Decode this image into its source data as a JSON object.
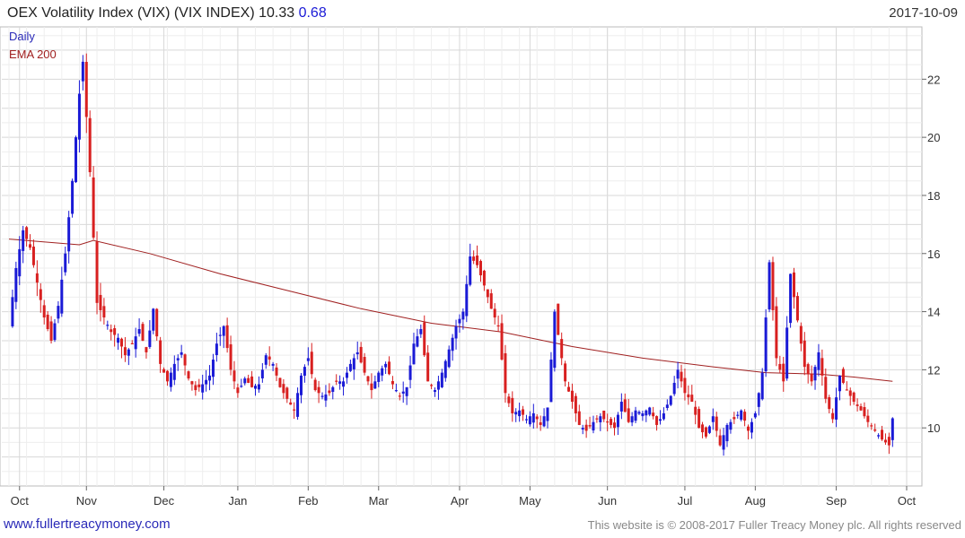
{
  "header": {
    "title": "OEX Volatility Index (VIX) (VIX INDEX) 10.33",
    "change": "0.68",
    "date": "2017-10-09"
  },
  "legend": {
    "daily": "Daily",
    "ema": "EMA 200"
  },
  "footer": {
    "site": "www.fullertreacymoney.com",
    "copyright": "This website is © 2008-2017 Fuller Treacy Money plc. All rights reserved"
  },
  "colors": {
    "up": "#1a1ad6",
    "down": "#d82020",
    "ema": "#a02020",
    "grid": "#e4e4e4"
  },
  "chart_data": {
    "type": "candlestick",
    "ylim": [
      8,
      23.8
    ],
    "yticks": [
      10,
      12,
      14,
      16,
      18,
      20,
      22
    ],
    "xlim": [
      0,
      250
    ],
    "months": [
      {
        "label": "Oct",
        "x": 3
      },
      {
        "label": "Nov",
        "x": 22
      },
      {
        "label": "Dec",
        "x": 44
      },
      {
        "label": "Jan",
        "x": 65
      },
      {
        "label": "Feb",
        "x": 85
      },
      {
        "label": "Mar",
        "x": 105
      },
      {
        "label": "Apr",
        "x": 128
      },
      {
        "label": "May",
        "x": 148
      },
      {
        "label": "Jun",
        "x": 170
      },
      {
        "label": "Jul",
        "x": 192
      },
      {
        "label": "Aug",
        "x": 212
      },
      {
        "label": "Sep",
        "x": 235
      },
      {
        "label": "Oct",
        "x": 255
      }
    ],
    "close_anchors": [
      [
        0,
        13.5
      ],
      [
        2,
        15.5
      ],
      [
        4,
        16.8
      ],
      [
        6,
        16.2
      ],
      [
        8,
        15.0
      ],
      [
        10,
        13.8
      ],
      [
        12,
        13.0
      ],
      [
        14,
        14.2
      ],
      [
        16,
        16.0
      ],
      [
        18,
        18.5
      ],
      [
        20,
        21.5
      ],
      [
        21,
        22.6
      ],
      [
        23,
        18.8
      ],
      [
        25,
        14.3
      ],
      [
        27,
        13.8
      ],
      [
        29,
        13.3
      ],
      [
        31,
        13.1
      ],
      [
        33,
        12.5
      ],
      [
        35,
        12.9
      ],
      [
        37,
        13.4
      ],
      [
        39,
        12.6
      ],
      [
        41,
        14.1
      ],
      [
        43,
        12.2
      ],
      [
        45,
        11.6
      ],
      [
        47,
        12.2
      ],
      [
        49,
        12.6
      ],
      [
        51,
        11.7
      ],
      [
        53,
        11.3
      ],
      [
        55,
        11.5
      ],
      [
        57,
        11.8
      ],
      [
        59,
        12.9
      ],
      [
        61,
        13.5
      ],
      [
        63,
        12.0
      ],
      [
        65,
        11.2
      ],
      [
        67,
        11.7
      ],
      [
        69,
        11.4
      ],
      [
        71,
        11.5
      ],
      [
        73,
        12.5
      ],
      [
        75,
        12.2
      ],
      [
        77,
        11.4
      ],
      [
        79,
        11.0
      ],
      [
        81,
        10.6
      ],
      [
        83,
        11.8
      ],
      [
        85,
        12.4
      ],
      [
        87,
        11.3
      ],
      [
        89,
        11.1
      ],
      [
        91,
        11.2
      ],
      [
        93,
        11.6
      ],
      [
        95,
        11.6
      ],
      [
        97,
        12.2
      ],
      [
        99,
        12.6
      ],
      [
        101,
        11.9
      ],
      [
        103,
        11.3
      ],
      [
        105,
        11.9
      ],
      [
        107,
        12.2
      ],
      [
        109,
        11.5
      ],
      [
        111,
        11.1
      ],
      [
        113,
        11.4
      ],
      [
        115,
        12.9
      ],
      [
        117,
        13.4
      ],
      [
        119,
        11.6
      ],
      [
        121,
        11.3
      ],
      [
        123,
        11.9
      ],
      [
        125,
        12.7
      ],
      [
        127,
        13.5
      ],
      [
        129,
        14.0
      ],
      [
        131,
        15.9
      ],
      [
        133,
        15.6
      ],
      [
        135,
        14.9
      ],
      [
        137,
        14.1
      ],
      [
        139,
        13.5
      ],
      [
        141,
        11.2
      ],
      [
        143,
        10.5
      ],
      [
        145,
        10.6
      ],
      [
        147,
        10.3
      ],
      [
        149,
        10.5
      ],
      [
        151,
        10.1
      ],
      [
        153,
        10.7
      ],
      [
        155,
        14.0
      ],
      [
        156,
        13.2
      ],
      [
        158,
        11.6
      ],
      [
        160,
        10.9
      ],
      [
        162,
        10.1
      ],
      [
        164,
        9.9
      ],
      [
        166,
        10.2
      ],
      [
        168,
        10.4
      ],
      [
        170,
        10.2
      ],
      [
        172,
        10.0
      ],
      [
        174,
        10.9
      ],
      [
        176,
        10.2
      ],
      [
        178,
        10.6
      ],
      [
        180,
        10.5
      ],
      [
        182,
        10.7
      ],
      [
        184,
        10.1
      ],
      [
        186,
        10.5
      ],
      [
        188,
        11.1
      ],
      [
        190,
        12.0
      ],
      [
        192,
        11.2
      ],
      [
        194,
        10.9
      ],
      [
        196,
        10.0
      ],
      [
        198,
        9.7
      ],
      [
        200,
        10.4
      ],
      [
        202,
        9.4
      ],
      [
        204,
        10.1
      ],
      [
        206,
        10.3
      ],
      [
        208,
        10.6
      ],
      [
        210,
        9.9
      ],
      [
        212,
        10.5
      ],
      [
        214,
        11.9
      ],
      [
        216,
        15.7
      ],
      [
        218,
        12.4
      ],
      [
        220,
        11.6
      ],
      [
        222,
        15.3
      ],
      [
        224,
        13.7
      ],
      [
        226,
        12.1
      ],
      [
        228,
        11.6
      ],
      [
        230,
        12.6
      ],
      [
        232,
        11.0
      ],
      [
        234,
        10.3
      ],
      [
        236,
        11.8
      ],
      [
        238,
        11.3
      ],
      [
        240,
        10.9
      ],
      [
        242,
        10.6
      ],
      [
        244,
        10.2
      ],
      [
        246,
        9.9
      ],
      [
        248,
        9.6
      ],
      [
        250,
        9.4
      ],
      [
        251,
        10.33
      ]
    ],
    "ema200": [
      [
        0,
        16.5
      ],
      [
        20,
        16.3
      ],
      [
        24,
        16.45
      ],
      [
        40,
        16.0
      ],
      [
        60,
        15.3
      ],
      [
        80,
        14.7
      ],
      [
        100,
        14.1
      ],
      [
        120,
        13.6
      ],
      [
        140,
        13.3
      ],
      [
        160,
        12.8
      ],
      [
        180,
        12.4
      ],
      [
        200,
        12.1
      ],
      [
        215,
        11.9
      ],
      [
        230,
        11.85
      ],
      [
        240,
        11.75
      ],
      [
        251,
        11.6
      ]
    ]
  }
}
